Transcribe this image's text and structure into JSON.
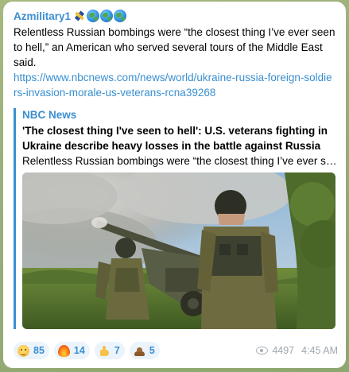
{
  "message": {
    "sender": "Azmilitary1",
    "sender_icons": [
      "satellite-icon",
      "globe-americas-icon",
      "globe-europe-africa-icon",
      "globe-asia-icon"
    ],
    "text": "Relentless Russian bombings were “the closest thing I’ve ever seen to hell,” an American who served several tours of the Middle East said.",
    "link": "https://www.nbcnews.com/news/world/ukraine-russia-foreign-soldiers-invasion-morale-us-veterans-rcna39268"
  },
  "preview": {
    "site": "NBC News",
    "title": "'The closest thing I've seen to hell': U.S. veterans fighting in Ukraine describe heavy losses in the battle against Russia",
    "description": "Relentless Russian bombings were “the closest thing I’ve ever seen to hell,” an American who served several tours of the Middle East...",
    "image_icon": "soldiers-firing-howitzer-photo"
  },
  "reactions": [
    {
      "icon": "grinning-face-icon",
      "count": "85"
    },
    {
      "icon": "fire-icon",
      "count": "14"
    },
    {
      "icon": "thumbs-up-icon",
      "count": "7"
    },
    {
      "icon": "poop-icon",
      "count": "5"
    }
  ],
  "meta": {
    "views": "4497",
    "time": "4:45 AM"
  },
  "colors": {
    "accent": "#3a8fd1",
    "background": "#9fb07a",
    "reaction_bg": "#ebf3fb",
    "meta_text": "#a0a7ae"
  }
}
